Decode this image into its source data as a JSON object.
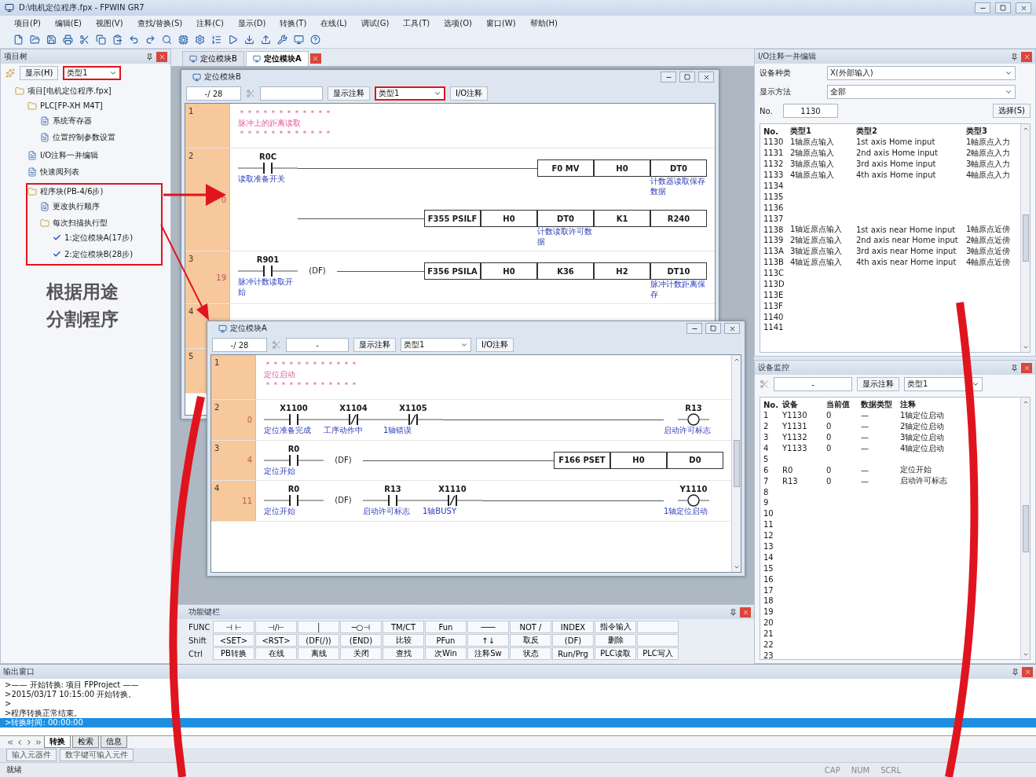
{
  "window": {
    "title": "D:\\电机定位程序.fpx - FPWIN GR7"
  },
  "menu": [
    "项目(P)",
    "编辑(E)",
    "视图(V)",
    "查找/替换(S)",
    "注释(C)",
    "显示(D)",
    "转换(T)",
    "在线(L)",
    "调试(G)",
    "工具(T)",
    "选项(O)",
    "窗口(W)",
    "帮助(H)"
  ],
  "project_panel": {
    "title": "项目树",
    "display_label": "显示(H)",
    "display_value": "类型1",
    "display_highlighted": true,
    "tree": [
      {
        "label": "项目[电机定位程序.fpx]",
        "highlighted": false,
        "children": [
          {
            "label": "PLC[FP-XH M4T]",
            "highlighted": false,
            "children": [
              {
                "label": "系统寄存器",
                "highlighted": false
              },
              {
                "label": "位置控制参数设置",
                "highlighted": false
              }
            ]
          },
          {
            "label": "I/O注释一并编辑",
            "highlighted": false
          },
          {
            "label": "快速阅列表",
            "highlighted": false
          },
          {
            "label": "程序块(PB-4/6步)",
            "highlighted": true,
            "children": [
              {
                "label": "更改执行顺序",
                "highlighted": false
              },
              {
                "label": "每次扫描执行型",
                "highlighted": false,
                "children": [
                  {
                    "label": "1:定位模块A(17步)",
                    "checked": true,
                    "highlighted": false
                  },
                  {
                    "label": "2:定位模块B(28步)",
                    "checked": true,
                    "highlighted": false
                  }
                ]
              }
            ]
          }
        ]
      }
    ]
  },
  "annotation": {
    "caption_lines": [
      "根据用途",
      "分割程序"
    ]
  },
  "doc_tabs": [
    {
      "label": "定位模块B",
      "selected": false
    },
    {
      "label": "定位模块A",
      "selected": true
    }
  ],
  "ladder_windows": [
    {
      "title": "定位模块B",
      "step_field": "-/ 28",
      "comment_button": "显示注释",
      "type_value": "类型1",
      "type_highlighted": true,
      "io_button": "I/O注释",
      "rows": [
        {
          "kind": "comment",
          "block": "1",
          "step": "",
          "lines": [
            "＊＊＊＊＊＊＊＊＊＊＊＊",
            "脉冲上的距离读取",
            "＊＊＊＊＊＊＊＊＊＊＊＊"
          ]
        },
        {
          "kind": "rung",
          "block": "2",
          "step": "0",
          "contacts": [
            {
              "kind": "no",
              "device": "R0C",
              "comment": "读取准备开关"
            }
          ],
          "outputs": [
            {
              "kind": "box",
              "cells": [
                {
                  "text": "F0 MV"
                },
                {
                  "text": "H0"
                },
                {
                  "text": "DT0",
                  "note": "计数器读取保存数据"
                }
              ]
            },
            {
              "kind": "box",
              "cells": [
                {
                  "text": "F355 PSILF"
                },
                {
                  "text": "H0"
                },
                {
                  "text": "DT0",
                  "note": "计数读取许可数据"
                },
                {
                  "text": "K1"
                },
                {
                  "text": "R240"
                }
              ]
            }
          ]
        },
        {
          "kind": "rung",
          "block": "3",
          "step": "19",
          "contacts": [
            {
              "kind": "no",
              "device": "R901",
              "comment": "脉冲计数读取开始"
            },
            {
              "kind": "df",
              "label": "(DF)"
            }
          ],
          "outputs": [
            {
              "kind": "box",
              "cells": [
                {
                  "text": "F356 PSILA"
                },
                {
                  "text": "H0"
                },
                {
                  "text": "K36"
                },
                {
                  "text": "H2"
                },
                {
                  "text": "DT10",
                  "note": "脉冲计数距离保存"
                }
              ]
            }
          ]
        },
        {
          "kind": "comment",
          "block": "4",
          "step": "",
          "lines": []
        },
        {
          "kind": "comment",
          "block": "5",
          "step": "",
          "lines": []
        }
      ]
    },
    {
      "title": "定位模块A",
      "step_field": "-/ 28",
      "search_value": "-",
      "comment_button": "显示注释",
      "type_value": "类型1",
      "type_highlighted": false,
      "io_button": "I/O注释",
      "rows": [
        {
          "kind": "comment",
          "block": "1",
          "step": "",
          "lines": [
            "＊＊＊＊＊＊＊＊＊＊＊＊",
            "定位启动",
            "＊＊＊＊＊＊＊＊＊＊＊＊"
          ]
        },
        {
          "kind": "rung",
          "block": "2",
          "step": "0",
          "contacts": [
            {
              "kind": "no",
              "device": "X1100",
              "comment": "定位准备完成"
            },
            {
              "kind": "nc",
              "device": "X1104",
              "comment": "工序动作中"
            },
            {
              "kind": "nc",
              "device": "X1105",
              "comment": "1轴错误"
            }
          ],
          "outputs": [
            {
              "kind": "coil",
              "device": "R13",
              "comment": "启动许可标志"
            }
          ]
        },
        {
          "kind": "rung",
          "block": "3",
          "step": "4",
          "contacts": [
            {
              "kind": "no",
              "device": "R0",
              "comment": "定位开始"
            },
            {
              "kind": "df",
              "label": "(DF)"
            }
          ],
          "outputs": [
            {
              "kind": "box",
              "cells": [
                {
                  "text": "F166 PSET"
                },
                {
                  "text": "H0"
                },
                {
                  "text": "D0"
                }
              ]
            }
          ]
        },
        {
          "kind": "rung",
          "block": "4",
          "step": "11",
          "contacts": [
            {
              "kind": "no",
              "device": "R0",
              "comment": "定位开始"
            },
            {
              "kind": "df",
              "label": "(DF)"
            },
            {
              "kind": "no",
              "device": "R13",
              "comment": "启动许可标志"
            },
            {
              "kind": "nc",
              "device": "X1110",
              "comment": "1轴BUSY"
            }
          ],
          "outputs": [
            {
              "kind": "coil",
              "device": "Y1110",
              "comment": "1轴定位启动"
            }
          ]
        }
      ]
    }
  ],
  "palette": {
    "title": "功能键栏",
    "rows": [
      [
        "FUNC",
        "⊣ ⊢",
        "⊣/⊢",
        "│",
        "─○⊣",
        "TM/CT",
        "Fun",
        "───",
        "NOT /",
        "INDEX",
        "指令输入",
        ""
      ],
      [
        "Shift",
        "<SET>",
        "<RST>",
        "(DF(/))",
        "(END)",
        "比较",
        "PFun",
        "↑↓",
        "取反",
        "(DF)",
        "删除",
        ""
      ],
      [
        "Ctrl",
        "PB转换",
        "在线",
        "离线",
        "关闭",
        "查找",
        "次Win",
        "注释Sw",
        "状态",
        "Run/Prg",
        "PLC读取",
        "PLC写入"
      ]
    ]
  },
  "io_panel": {
    "title": "I/O注释一并编辑",
    "device_label": "设备种类",
    "device_value": "X(外部输入)",
    "method_label": "显示方法",
    "method_value": "全部",
    "no_label": "No.",
    "no_value": "1130",
    "select_button": "选择(S)",
    "columns": [
      "No.",
      "类型1",
      "类型2",
      "类型3"
    ],
    "rows": [
      [
        "1130",
        "1轴原点输入",
        "1st axis Home input",
        "1軸原点入力"
      ],
      [
        "1131",
        "2轴原点输入",
        "2nd axis Home input",
        "2軸原点入力"
      ],
      [
        "1132",
        "3轴原点输入",
        "3rd axis Home input",
        "3軸原点入力"
      ],
      [
        "1133",
        "4轴原点输入",
        "4th axis Home input",
        "4軸原点入力"
      ],
      [
        "1134",
        "",
        "",
        ""
      ],
      [
        "1135",
        "",
        "",
        ""
      ],
      [
        "1136",
        "",
        "",
        ""
      ],
      [
        "1137",
        "",
        "",
        ""
      ],
      [
        "1138",
        "1轴近原点输入",
        "1st axis near Home input",
        "1軸原点近傍"
      ],
      [
        "1139",
        "2轴近原点输入",
        "2nd axis near Home input",
        "2軸原点近傍"
      ],
      [
        "113A",
        "3轴近原点输入",
        "3rd axis near Home input",
        "3軸原点近傍"
      ],
      [
        "113B",
        "4轴近原点输入",
        "4th axis near Home input",
        "4軸原点近傍"
      ],
      [
        "113C",
        "",
        "",
        ""
      ],
      [
        "113D",
        "",
        "",
        ""
      ],
      [
        "113E",
        "",
        "",
        ""
      ],
      [
        "113F",
        "",
        "",
        ""
      ],
      [
        "1140",
        "",
        "",
        ""
      ],
      [
        "1141",
        "",
        "",
        ""
      ]
    ]
  },
  "monitor_panel": {
    "title": "设备监控",
    "search_value": "-",
    "comment_button": "显示注释",
    "type_value": "类型1",
    "columns": [
      "No.",
      "设备",
      "当前值",
      "数据类型",
      "注释"
    ],
    "rows": [
      [
        "1",
        "Y1130",
        "0",
        "—",
        "1轴定位启动"
      ],
      [
        "2",
        "Y1131",
        "0",
        "—",
        "2轴定位启动"
      ],
      [
        "3",
        "Y1132",
        "0",
        "—",
        "3轴定位启动"
      ],
      [
        "4",
        "Y1133",
        "0",
        "—",
        "4轴定位启动"
      ],
      [
        "5",
        "",
        "",
        "",
        ""
      ],
      [
        "6",
        "R0",
        "0",
        "—",
        "定位开始"
      ],
      [
        "7",
        "R13",
        "0",
        "—",
        "启动许可标志"
      ],
      [
        "8",
        "",
        "",
        "",
        ""
      ],
      [
        "9",
        "",
        "",
        "",
        ""
      ],
      [
        "10",
        "",
        "",
        "",
        ""
      ],
      [
        "11",
        "",
        "",
        "",
        ""
      ],
      [
        "12",
        "",
        "",
        "",
        ""
      ],
      [
        "13",
        "",
        "",
        "",
        ""
      ],
      [
        "14",
        "",
        "",
        "",
        ""
      ],
      [
        "15",
        "",
        "",
        "",
        ""
      ],
      [
        "16",
        "",
        "",
        "",
        ""
      ],
      [
        "17",
        "",
        "",
        "",
        ""
      ],
      [
        "18",
        "",
        "",
        "",
        ""
      ],
      [
        "19",
        "",
        "",
        "",
        ""
      ],
      [
        "20",
        "",
        "",
        "",
        ""
      ],
      [
        "21",
        "",
        "",
        "",
        ""
      ],
      [
        "22",
        "",
        "",
        "",
        ""
      ],
      [
        "23",
        "",
        "",
        "",
        ""
      ]
    ]
  },
  "output_panel": {
    "title": "输出窗口",
    "lines": [
      {
        "text": ">—— 开始转换: 项目 FPProject ——",
        "selected": false
      },
      {
        "text": ">2015/03/17 10:15:00 开始转换。",
        "selected": false
      },
      {
        "text": ">",
        "selected": false
      },
      {
        "text": ">程序转换正常结束。",
        "selected": false
      },
      {
        "text": ">转换时间: 00:00:00",
        "selected": true
      }
    ],
    "tabs": [
      {
        "label": "转换",
        "selected": true
      },
      {
        "label": "检索",
        "selected": false
      },
      {
        "label": "信息",
        "selected": false
      }
    ]
  },
  "input_bar": {
    "fields": [
      "输入元器件",
      "数字键可输入元件"
    ]
  },
  "status_bar": {
    "message": "就绪",
    "indicators": [
      "CAP",
      "NUM",
      "SCRL"
    ]
  }
}
